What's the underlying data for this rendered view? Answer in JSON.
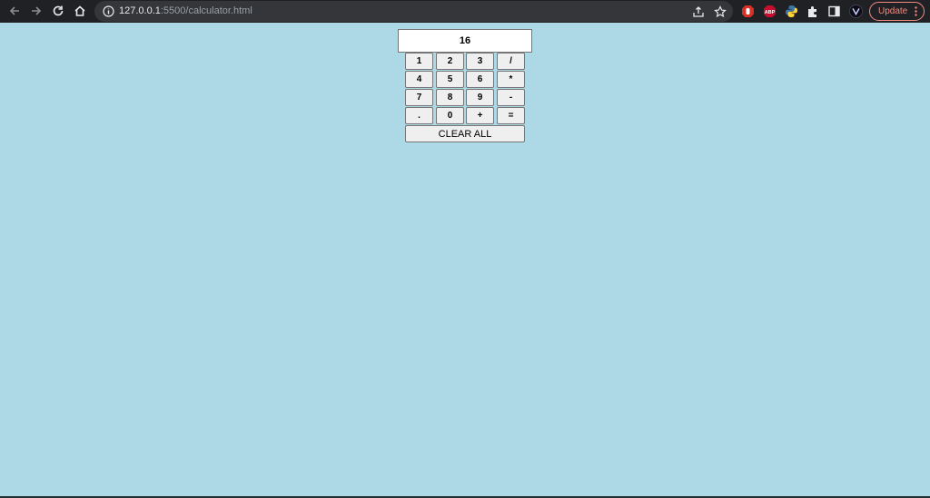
{
  "browser": {
    "url_host": "127.0.0.1",
    "url_path": ":5500/calculator.html",
    "update_label": "Update",
    "icons": [
      "back-arrow-icon",
      "forward-arrow-icon",
      "reload-icon",
      "home-icon",
      "info-icon",
      "share-icon",
      "star-icon",
      "adblock-hand-icon",
      "abp-icon",
      "python-icon",
      "puzzle-icon",
      "sidebar-icon",
      "profile-v-icon",
      "kebab-menu-icon"
    ],
    "abp_label": "ABP",
    "colors": {
      "chrome": "#202124",
      "omnibox": "#35363a",
      "update": "#f28b82"
    }
  },
  "calculator": {
    "display_value": "16",
    "keys": [
      [
        "1",
        "2",
        "3",
        "/"
      ],
      [
        "4",
        "5",
        "6",
        "*"
      ],
      [
        "7",
        "8",
        "9",
        "-"
      ],
      [
        ".",
        "0",
        "+",
        "="
      ]
    ],
    "clear_label": "CLEAR ALL",
    "colors": {
      "page_background": "#add8e6",
      "key_background": "#efefef",
      "display_background": "#ffffff"
    }
  }
}
